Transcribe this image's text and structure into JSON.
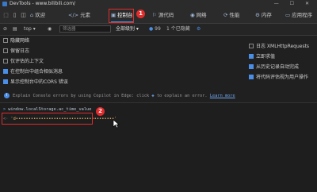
{
  "window": {
    "title": "DevTools - www.bilibili.com/",
    "controls": "— ☐ ✕"
  },
  "tabs": [
    {
      "label": "欢迎",
      "icon": "⌂"
    },
    {
      "label": "元素",
      "icon": "</>"
    },
    {
      "label": "控制台",
      "icon": "▣"
    },
    {
      "label": "源代码",
      "icon": "⚐"
    },
    {
      "label": "网络",
      "icon": "◉"
    },
    {
      "label": "性能",
      "icon": "⟳"
    },
    {
      "label": "内存",
      "icon": "⚙"
    },
    {
      "label": "应用程序",
      "icon": "▭"
    }
  ],
  "toolbar": {
    "context": "top",
    "filter_placeholder": "筛选器",
    "levels": "全部级别",
    "issues_count": "99",
    "hidden": "1 个已隐藏"
  },
  "settings_left": [
    {
      "label": "隐藏网络",
      "checked": false
    },
    {
      "label": "保留日志",
      "checked": false
    },
    {
      "label": "仅评估的上下文",
      "checked": false
    },
    {
      "label": "在控制台中组合相似消息",
      "checked": true
    },
    {
      "label": "显示控制台中的CORS 错误",
      "checked": true
    }
  ],
  "settings_right": [
    {
      "label": "日志 XMLHttpRequests",
      "checked": false
    },
    {
      "label": "立即求值",
      "checked": true
    },
    {
      "label": "从历史记录自动完成",
      "checked": true
    },
    {
      "label": "将代码评估视为用户操作",
      "checked": true
    }
  ],
  "banner": {
    "text": "Explain Console errors by using Copilot in Edge: click",
    "text2": "to explain an error.",
    "link": "Learn more"
  },
  "console": {
    "command": "window.localStorage.ac_time_value",
    "result": "'d•••••••••••••••••••••••••••••••••••••••'"
  },
  "annotations": {
    "badge1": "1",
    "badge2": "2"
  },
  "colors": {
    "accent": "#4a8fe7",
    "annotation": "#e02c2c"
  }
}
